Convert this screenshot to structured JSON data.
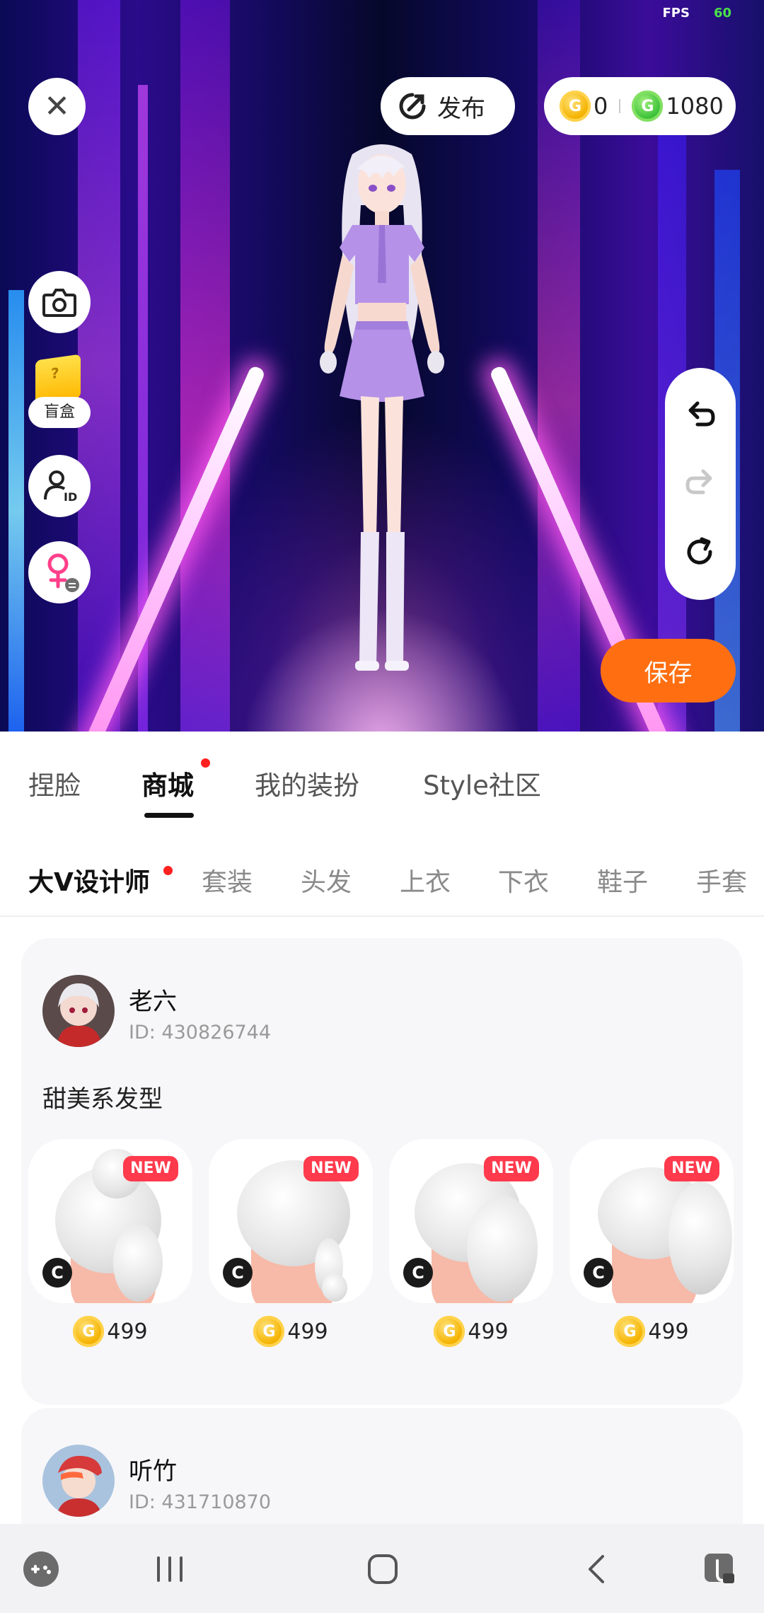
{
  "status": {
    "fps_label": "FPS",
    "fps_value": "60"
  },
  "toolbar": {
    "publish_label": "发布",
    "currency": [
      {
        "type": "gold",
        "value": "0"
      },
      {
        "type": "green",
        "value": "1080"
      }
    ]
  },
  "side_tools": {
    "blindbox_label": "盲盒"
  },
  "actions": {
    "save_label": "保存"
  },
  "tabs": [
    {
      "label": "捏脸",
      "active": false,
      "dot": false
    },
    {
      "label": "商城",
      "active": true,
      "dot": true
    },
    {
      "label": "我的装扮",
      "active": false,
      "dot": false
    },
    {
      "label": "Style社区",
      "active": false,
      "dot": false
    }
  ],
  "subtabs": [
    {
      "label": "大V设计师",
      "active": true,
      "dot": true
    },
    {
      "label": "套装"
    },
    {
      "label": "头发"
    },
    {
      "label": "上衣"
    },
    {
      "label": "下衣"
    },
    {
      "label": "鞋子"
    },
    {
      "label": "手套"
    }
  ],
  "designers": [
    {
      "name": "老六",
      "id_text": "ID: 430826744",
      "collection_title": "甜美系发型",
      "items": [
        {
          "badge": "NEW",
          "c_badge": "C",
          "price": "499"
        },
        {
          "badge": "NEW",
          "c_badge": "C",
          "price": "499"
        },
        {
          "badge": "NEW",
          "c_badge": "C",
          "price": "499"
        },
        {
          "badge": "NEW",
          "c_badge": "C",
          "price": "499"
        }
      ]
    },
    {
      "name": "听竹",
      "id_text": "ID: 431710870"
    }
  ],
  "colors": {
    "accent": "#ff6f12",
    "new_badge": "#ff3a4c",
    "dot": "#ff2020"
  }
}
